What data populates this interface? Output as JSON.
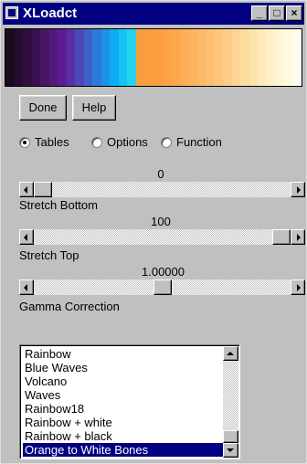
{
  "window": {
    "title": "XLoadct",
    "controls": {
      "minimize": "_",
      "maximize": "□",
      "close": "×"
    }
  },
  "colorbar": {
    "colors": [
      "#1a0a1e",
      "#240d2d",
      "#2e0f3e",
      "#3a124f",
      "#461565",
      "#52197a",
      "#5e1c91",
      "#5a2fa6",
      "#4b48b8",
      "#3c61c9",
      "#2c7ad9",
      "#1c93e7",
      "#10acf2",
      "#14c2f3",
      "#26d2ec",
      "#f99d3f",
      "#fb9e3f",
      "#fc9f40",
      "#fda246",
      "#fda74d",
      "#fdad56",
      "#fdb35e",
      "#fdb967",
      "#fdbf70",
      "#fdc67b",
      "#fdcd87",
      "#fdd493",
      "#fddc9f",
      "#fee3ad",
      "#feeaba",
      "#fef0c8",
      "#fff5d4",
      "#fff9e2",
      "#fffcee"
    ]
  },
  "buttons": {
    "done": "Done",
    "help": "Help"
  },
  "radios": {
    "selected": "tables",
    "items": [
      {
        "id": "tables",
        "label": "Tables"
      },
      {
        "id": "options",
        "label": "Options"
      },
      {
        "id": "function",
        "label": "Function"
      }
    ]
  },
  "sliders": {
    "stretch_bottom": {
      "value_text": "0",
      "label": "Stretch Bottom",
      "fraction": 0.0
    },
    "stretch_top": {
      "value_text": "100",
      "label": "Stretch Top",
      "fraction": 1.0
    },
    "gamma": {
      "value_text": "1.00000",
      "label": "Gamma Correction",
      "fraction": 0.5
    }
  },
  "table_list": {
    "items": [
      "Rainbow",
      "Blue Waves",
      "Volcano",
      "Waves",
      "Rainbow18",
      "Rainbow + white",
      "Rainbow + black",
      "Orange to White Bones"
    ],
    "selected_index": 7
  }
}
